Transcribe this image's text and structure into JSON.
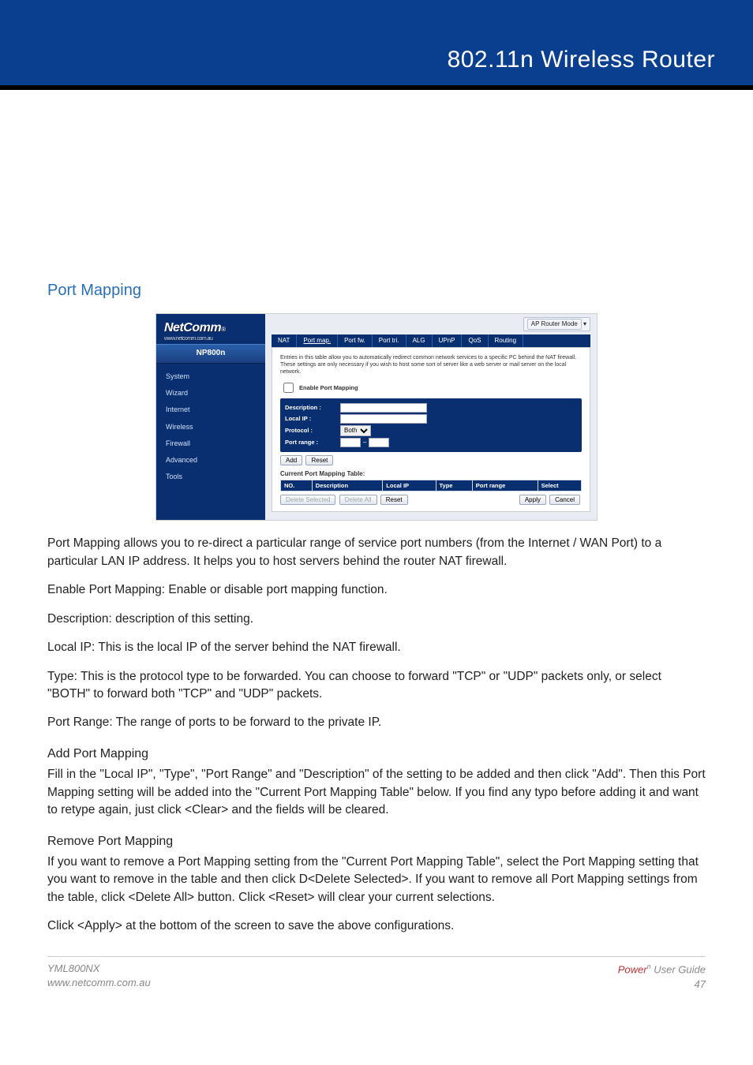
{
  "header": {
    "title": "802.11n Wireless Router"
  },
  "section": {
    "title": "Port Mapping"
  },
  "screenshot": {
    "logo": "NetComm",
    "logo_reg": "®",
    "logo_url": "www.netcomm.com.au",
    "model": "NP800n",
    "sidebar": [
      "System",
      "Wizard",
      "Internet",
      "Wireless",
      "Firewall",
      "Advanced",
      "Tools"
    ],
    "mode_label": "AP Router Mode",
    "tabs": [
      "NAT",
      "Port map.",
      "Port fw.",
      "Port tri.",
      "ALG",
      "UPnP",
      "QoS",
      "Routing"
    ],
    "active_tab": 1,
    "intro": "Entries in this table allow you to automatically redirect common network services to a specific PC behind the NAT firewall. These settings are only necessary if you wish to host some sort of server like a web server or mail server on the local network.",
    "enable_label": "Enable Port Mapping",
    "fields": {
      "description": "Description :",
      "local_ip": "Local IP :",
      "protocol": "Protocol :",
      "protocol_value": "Both",
      "port_range": "Port range :",
      "dash": "–"
    },
    "row_buttons": {
      "add": "Add",
      "reset": "Reset"
    },
    "table_title": "Current Port Mapping Table:",
    "columns": [
      "NO.",
      "Description",
      "Local IP",
      "Type",
      "Port range",
      "Select"
    ],
    "actions": {
      "delete_selected": "Delete Selected",
      "delete_all": "Delete All",
      "reset": "Reset",
      "apply": "Apply",
      "cancel": "Cancel"
    }
  },
  "body": {
    "intro": "Port Mapping allows you to re-direct a particular range of service port numbers (from the Internet / WAN Port) to a particular LAN IP address. It helps you to host servers behind the router NAT firewall.",
    "items": [
      {
        "label": "Enable Port Mapping",
        "text": ": Enable or disable port mapping function."
      },
      {
        "label": "Description",
        "text": ": description of this setting."
      },
      {
        "label": "Local IP",
        "text": ": This is the local IP of the server behind the NAT firewall."
      },
      {
        "label": "Type",
        "text": ": This is the protocol type to be forwarded. You can choose to forward \"TCP\" or \"UDP\" packets only, or select \"BOTH\" to forward both \"TCP\" and \"UDP\" packets."
      },
      {
        "label": "Port Range",
        "text": ": The range of ports to be forward to the private IP."
      }
    ],
    "add_head": "Add Port Mapping",
    "add_text": "Fill in the \"Local IP\", \"Type\", \"Port Range\" and \"Description\" of the setting to be added and then click \"Add\". Then this Port Mapping setting will be added into the \"Current Port Mapping Table\" below. If you find any typo before adding it and want to retype again, just click <Clear> and the fields will be cleared.",
    "remove_head": "Remove Port Mapping",
    "remove_text": "If you want to remove a Port Mapping setting from the \"Current Port Mapping Table\", select the Port Mapping setting that you want to remove in the table and then click D<Delete Selected>. If you want to remove all Port Mapping settings from the table, click <Delete All> button. Click <Reset> will clear your current selections.",
    "final": "Click <Apply> at the bottom of the screen to save the above configurations."
  },
  "footer": {
    "model": "YML800NX",
    "url": "www.netcomm.com.au",
    "brand": "Power",
    "sup": "n",
    "guide": " User Guide",
    "page": "47"
  }
}
